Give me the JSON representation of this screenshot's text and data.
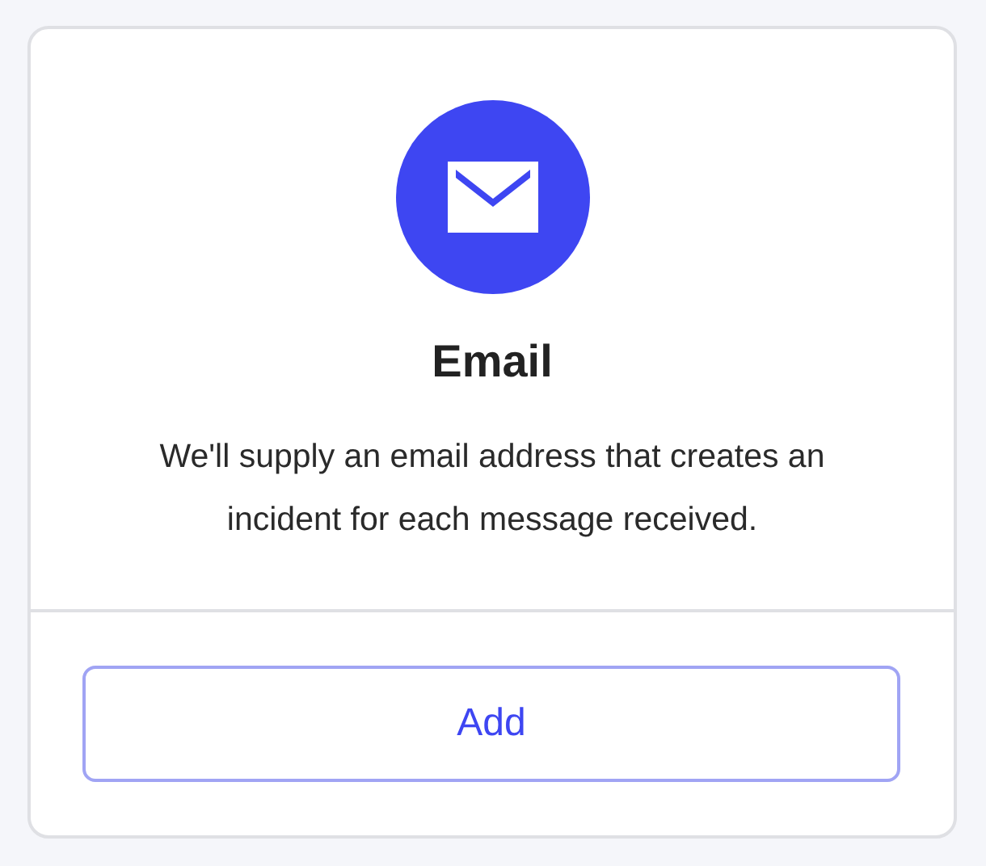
{
  "card": {
    "title": "Email",
    "description": "We'll supply an email address that creates an incident for each message received.",
    "button": "Add"
  }
}
